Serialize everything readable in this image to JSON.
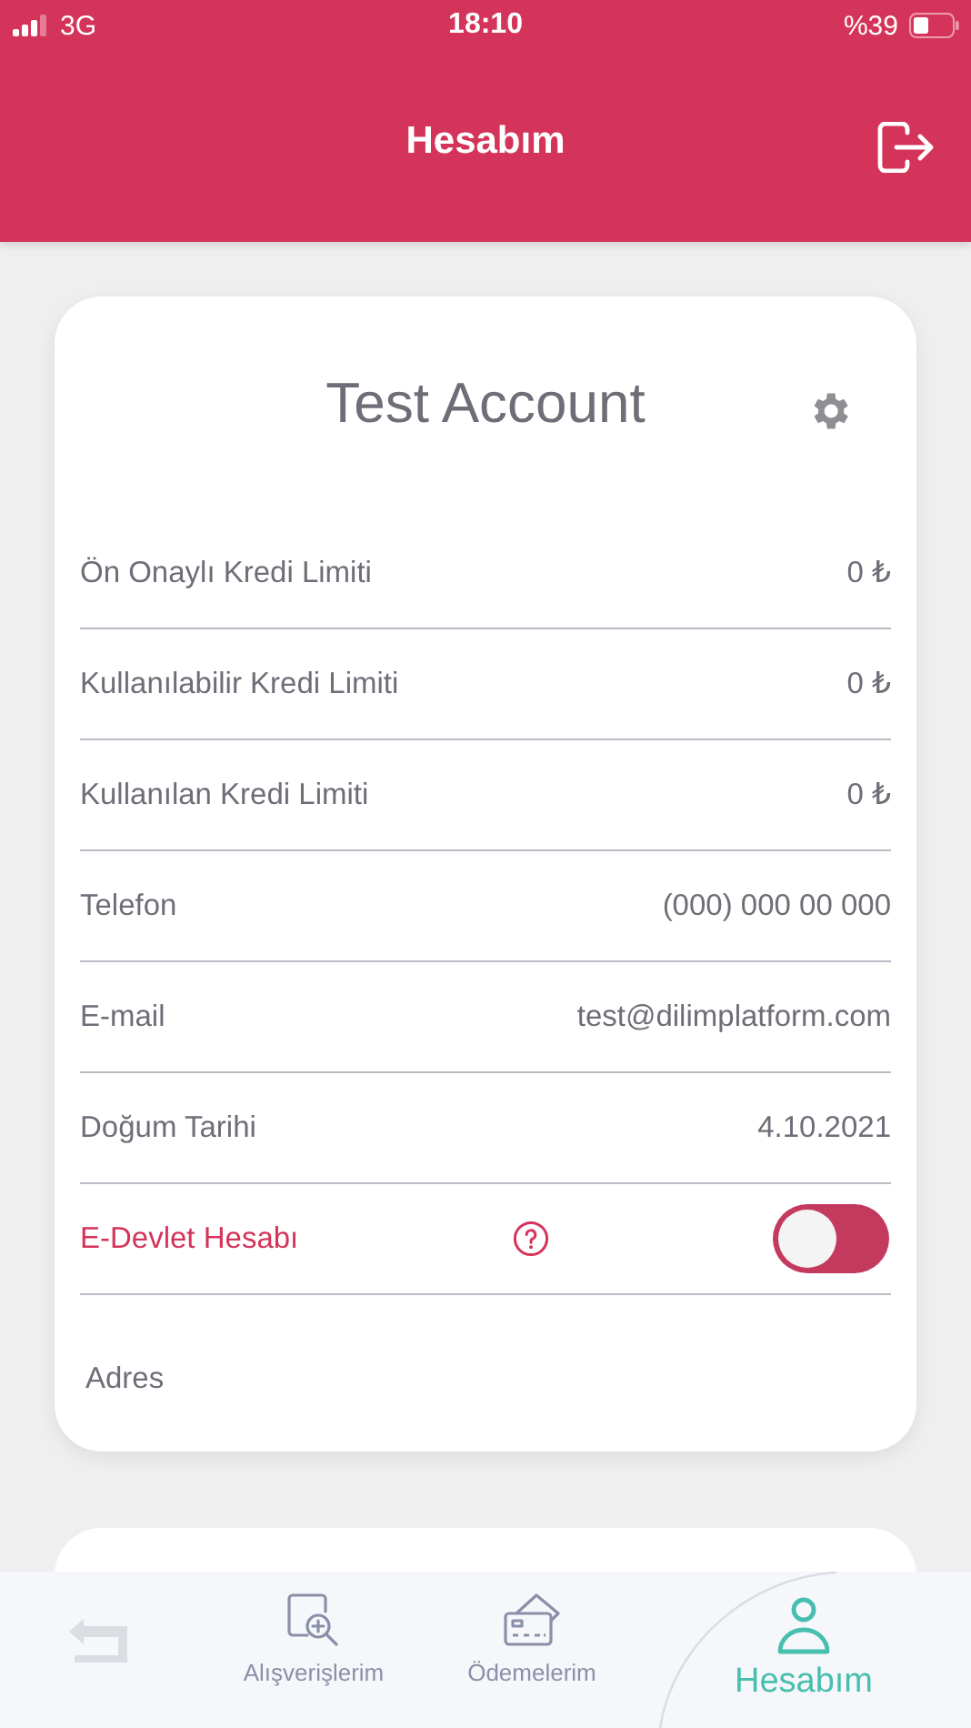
{
  "status_bar": {
    "network": "3G",
    "time": "18:10",
    "battery_text": "%39"
  },
  "header": {
    "title": "Hesabım"
  },
  "account_card": {
    "title": "Test Account",
    "rows": [
      {
        "kind": "value",
        "label": "Ön Onaylı Kredi Limiti",
        "value": "0 ₺"
      },
      {
        "kind": "value",
        "label": "Kullanılabilir Kredi Limiti",
        "value": "0 ₺"
      },
      {
        "kind": "value",
        "label": "Kullanılan Kredi Limiti",
        "value": "0 ₺"
      },
      {
        "kind": "value",
        "label": "Telefon",
        "value": "(000) 000 00 000"
      },
      {
        "kind": "value",
        "label": "E-mail",
        "value": "test@dilimplatform.com"
      },
      {
        "kind": "value",
        "label": "Doğum Tarihi",
        "value": "4.10.2021"
      },
      {
        "kind": "toggle",
        "label": "E-Devlet Hesabı",
        "on": false
      },
      {
        "kind": "address",
        "label": "Adres"
      }
    ]
  },
  "tab_bar": {
    "items": [
      {
        "kind": "back",
        "selected": false
      },
      {
        "kind": "search",
        "label": "Alışverişlerim",
        "selected": false
      },
      {
        "kind": "card",
        "label": "Ödemelerim",
        "selected": false
      },
      {
        "kind": "user",
        "label": "Hesabım",
        "selected": true
      }
    ]
  }
}
